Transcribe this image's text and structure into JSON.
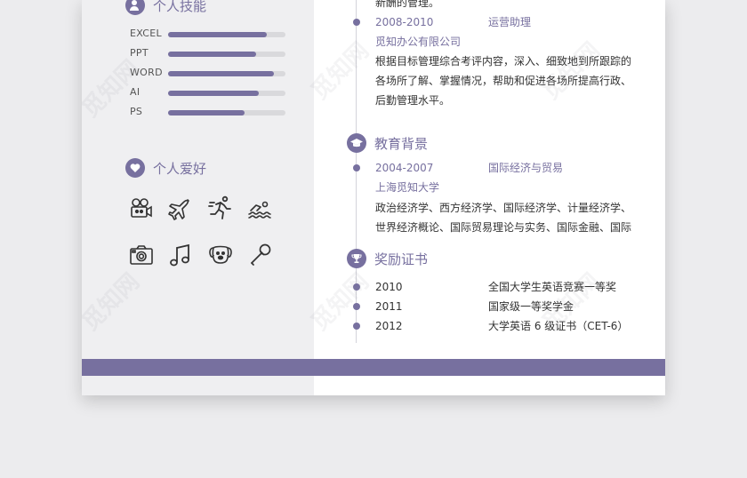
{
  "skills": {
    "title": "个人技能",
    "items": [
      {
        "label": "EXCEL",
        "level": 0.84
      },
      {
        "label": "PPT",
        "level": 0.75
      },
      {
        "label": "WORD",
        "level": 0.9
      },
      {
        "label": "AI",
        "level": 0.77
      },
      {
        "label": "PS",
        "level": 0.65
      }
    ]
  },
  "hobbies": {
    "title": "个人爱好",
    "icons": [
      "camera-icon",
      "plane-icon",
      "running-icon",
      "swimming-icon",
      "photo-camera-icon",
      "music-note-icon",
      "dog-icon",
      "microphone-icon"
    ]
  },
  "work": {
    "intro_tail": "新酬的管理。",
    "period": "2008-2010",
    "position": "运营助理",
    "company": "觅知办公有限公司",
    "description": "根据目标管理综合考评内容，深入、细致地到所跟踪的各场所了解、掌握情况，帮助和促进各场所提高行政、后勤管理水平。"
  },
  "education": {
    "title": "教育背景",
    "period": "2004-2007",
    "major": "国际经济与贸易",
    "school": "上海觅知大学",
    "courses": "政治经济学、西方经济学、国际经济学、计量经济学、世界经济概论、国际贸易理论与实务、国际金融、国际结算"
  },
  "awards": {
    "title": "奖励证书",
    "items": [
      {
        "year": "2010",
        "name": "全国大学生英语竞赛一等奖"
      },
      {
        "year": "2011",
        "name": "国家级一等奖学金"
      },
      {
        "year": "2012",
        "name": "大学英语 6 级证书（CET-6）"
      }
    ]
  },
  "watermark": "觅知网",
  "colors": {
    "accent": "#77709f",
    "sidebar": "#efeff1"
  }
}
